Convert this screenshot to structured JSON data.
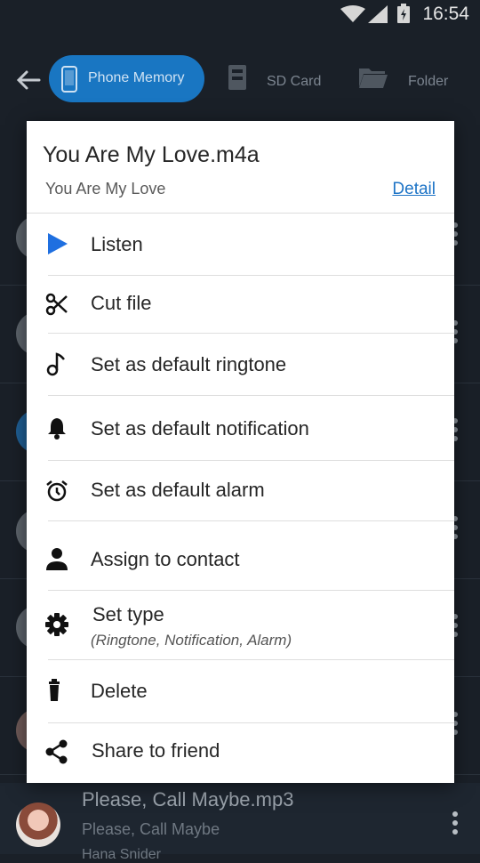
{
  "status": {
    "time": "16:54"
  },
  "tabs": [
    {
      "label": "Phone Memory",
      "active": true
    },
    {
      "label": "SD Card",
      "active": false
    },
    {
      "label": "Folder",
      "active": false
    }
  ],
  "background_list": {
    "last_title": "Please, Call Maybe.mp3",
    "last_sub": "Please, Call Maybe",
    "last_sub2": "Hana Snider"
  },
  "dialog": {
    "title": "You Are My Love.m4a",
    "subtitle": "You Are My Love",
    "detail_link": "Detail",
    "items": [
      {
        "label": "Listen",
        "icon": "play-icon"
      },
      {
        "label": "Cut file",
        "icon": "scissors-icon"
      },
      {
        "label": "Set as default ringtone",
        "icon": "music-note-icon"
      },
      {
        "label": "Set as default notification",
        "icon": "bell-icon"
      },
      {
        "label": "Set as default alarm",
        "icon": "alarm-clock-icon"
      },
      {
        "label": "Assign to contact",
        "icon": "person-icon"
      },
      {
        "label": "Set type",
        "hint": "(Ringtone, Notification, Alarm)",
        "icon": "gear-icon"
      },
      {
        "label": "Delete",
        "icon": "trash-icon"
      },
      {
        "label": "Share to friend",
        "icon": "share-icon"
      }
    ]
  },
  "colors": {
    "accent": "#1976c2",
    "play": "#1f6fe0",
    "link": "#1e74c6"
  }
}
